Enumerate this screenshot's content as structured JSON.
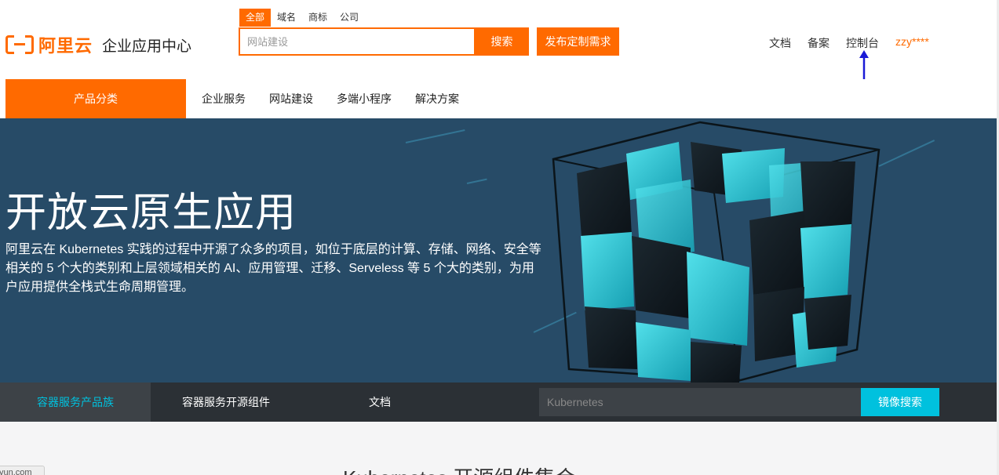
{
  "header": {
    "logo_text": "阿里云",
    "logo_sub": "企业应用中心",
    "search_tabs": [
      "全部",
      "域名",
      "商标",
      "公司"
    ],
    "search_placeholder": "网站建设",
    "search_button": "搜索",
    "publish_button": "发布定制需求",
    "links": [
      "文档",
      "备案",
      "控制台"
    ],
    "user": "zzy****"
  },
  "nav": {
    "category": "产品分类",
    "items": [
      "企业服务",
      "网站建设",
      "多端小程序",
      "解决方案"
    ]
  },
  "hero": {
    "title": "开放云原生应用",
    "description": "阿里云在 Kubernetes 实践的过程中开源了众多的项目，如位于底层的计算、存储、网络、安全等相关的 5 个大的类别和上层领域相关的 AI、应用管理、迁移、Serveless 等 5 个大的类别，为用户应用提供全栈式生命周期管理。"
  },
  "subnav": {
    "tabs": [
      "容器服务产品族",
      "容器服务开源组件",
      "文档"
    ],
    "active_tab": 0,
    "mirror_placeholder": "Kubernetes",
    "mirror_button": "镜像搜索"
  },
  "content": {
    "section_title": "Kubernetes 开源组件集合",
    "corner_badge": "yun.com"
  },
  "colors": {
    "brand": "#ff6a00",
    "hero_bg": "#274b67",
    "subnav_bg": "#2b3035",
    "accent": "#00c1de"
  }
}
